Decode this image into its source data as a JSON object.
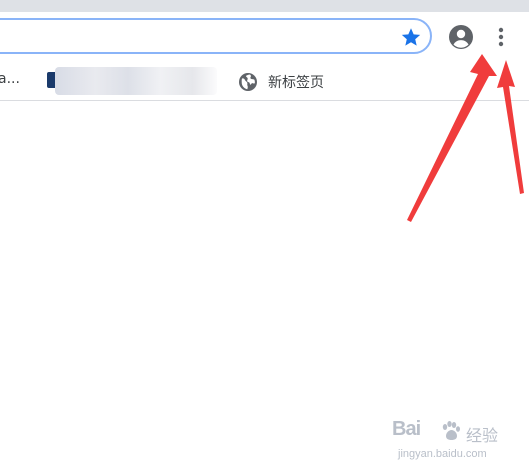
{
  "bookmarks_bar": {
    "partial_item_label": "a...",
    "new_tab_label": "新标签页"
  },
  "toolbar": {
    "star_icon": "star-icon",
    "profile_icon": "account-circle-icon",
    "menu_icon": "three-dot-menu-icon",
    "star_color": "#1a73e8"
  },
  "annotation": {
    "arrow_color": "#f03c3c"
  },
  "watermark": {
    "logo_text": "Bai",
    "brand_text": "经验",
    "url_text": "jingyan.baidu.com"
  }
}
